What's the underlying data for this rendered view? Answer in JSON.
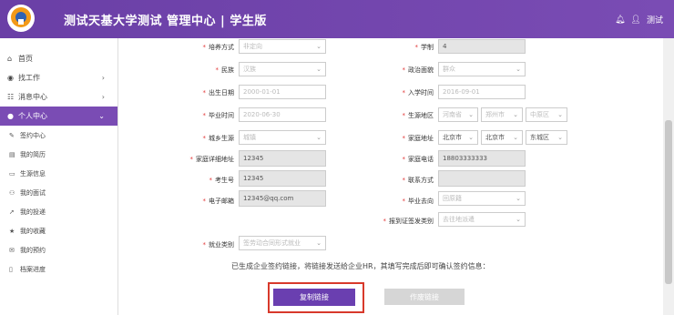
{
  "header": {
    "title": "测试天基大学测试 管理中心 | 学生版",
    "user_name": "测试"
  },
  "sidebar": {
    "items": [
      {
        "label": "首页",
        "icon": "home-icon",
        "glyph": "⌂",
        "arrow": ""
      },
      {
        "label": "找工作",
        "icon": "eye-icon",
        "glyph": "◉",
        "arrow": "›"
      },
      {
        "label": "消息中心",
        "icon": "message-icon",
        "glyph": "☷",
        "arrow": "›"
      },
      {
        "label": "个人中心",
        "icon": "user-icon",
        "glyph": "●",
        "arrow": "⌄"
      }
    ],
    "subitems": [
      {
        "label": "签约中心",
        "icon": "edit-icon",
        "glyph": "✎"
      },
      {
        "label": "我的简历",
        "icon": "resume-icon",
        "glyph": "▤"
      },
      {
        "label": "生源信息",
        "icon": "id-card-icon",
        "glyph": "▭"
      },
      {
        "label": "我的面试",
        "icon": "group-icon",
        "glyph": "⚇"
      },
      {
        "label": "我的投递",
        "icon": "send-icon",
        "glyph": "➚"
      },
      {
        "label": "我的收藏",
        "icon": "star-icon",
        "glyph": "★"
      },
      {
        "label": "我的预约",
        "icon": "comment-icon",
        "glyph": "✉"
      },
      {
        "label": "档案进度",
        "icon": "file-icon",
        "glyph": "▯"
      }
    ]
  },
  "form": {
    "training_mode": {
      "label": "培养方式",
      "value": "非定向"
    },
    "duration": {
      "label": "学制",
      "value": "4"
    },
    "ethnicity": {
      "label": "民族",
      "value": "汉族"
    },
    "political": {
      "label": "政治面貌",
      "value": "群众"
    },
    "birth_date": {
      "label": "出生日期",
      "value": "2000-01-01"
    },
    "enroll_date": {
      "label": "入学时间",
      "value": "2016-09-01"
    },
    "grad_date": {
      "label": "毕业时间",
      "value": "2020-06-30"
    },
    "origin_region": {
      "label": "生源地区",
      "province": "河南省",
      "city": "郑州市",
      "district": "中原区"
    },
    "urban_rural": {
      "label": "城乡生源",
      "value": "城镇"
    },
    "home_address": {
      "label": "家庭地址",
      "province": "北京市",
      "city": "北京市",
      "district": "东城区"
    },
    "home_detail": {
      "label": "家庭详细地址",
      "value": "12345"
    },
    "home_phone": {
      "label": "家庭电话",
      "value": "18803333333"
    },
    "exam_no": {
      "label": "考生号",
      "value": "12345"
    },
    "contact": {
      "label": "联系方式",
      "value": ""
    },
    "email": {
      "label": "电子邮箱",
      "value": "12345@qq.com"
    },
    "grad_direction": {
      "label": "毕业去向",
      "value": "回原籍"
    },
    "report_type": {
      "label": "报到证签发类别",
      "value": "去往地派遣"
    },
    "employment_type": {
      "label": "就业类别",
      "value": "签劳动合同形式就业"
    }
  },
  "notice": "已生成企业签约链接，将链接发送给企业HR，其填写完成后即可确认签约信息：",
  "buttons": {
    "copy": "复制链接",
    "void": "作废链接"
  }
}
